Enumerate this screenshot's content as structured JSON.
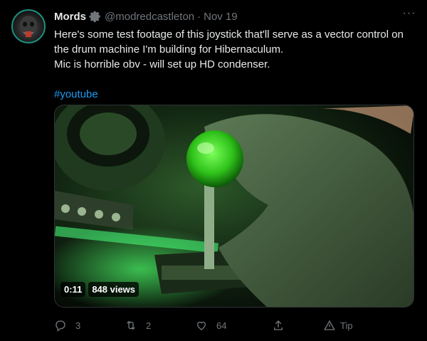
{
  "user": {
    "name": "Mords",
    "handle": "@modredcastleton",
    "separator": "·",
    "date": "Nov 19"
  },
  "tweet": {
    "text": "Here's some test footage of this joystick that'll serve as a vector control on\nthe drum machine I'm building for Hibernaculum.\nMic is horrible obv - will set up HD condenser.",
    "hashtag": "#youtube"
  },
  "media": {
    "duration": "0:11",
    "views": "848 views"
  },
  "actions": {
    "reply_count": "3",
    "retweet_count": "2",
    "like_count": "64",
    "tip_label": "Tip"
  },
  "more_label": "···",
  "colors": {
    "accent": "#1d9bf0",
    "muted": "#71767b",
    "text": "#e7e9ea",
    "background": "#000000"
  }
}
